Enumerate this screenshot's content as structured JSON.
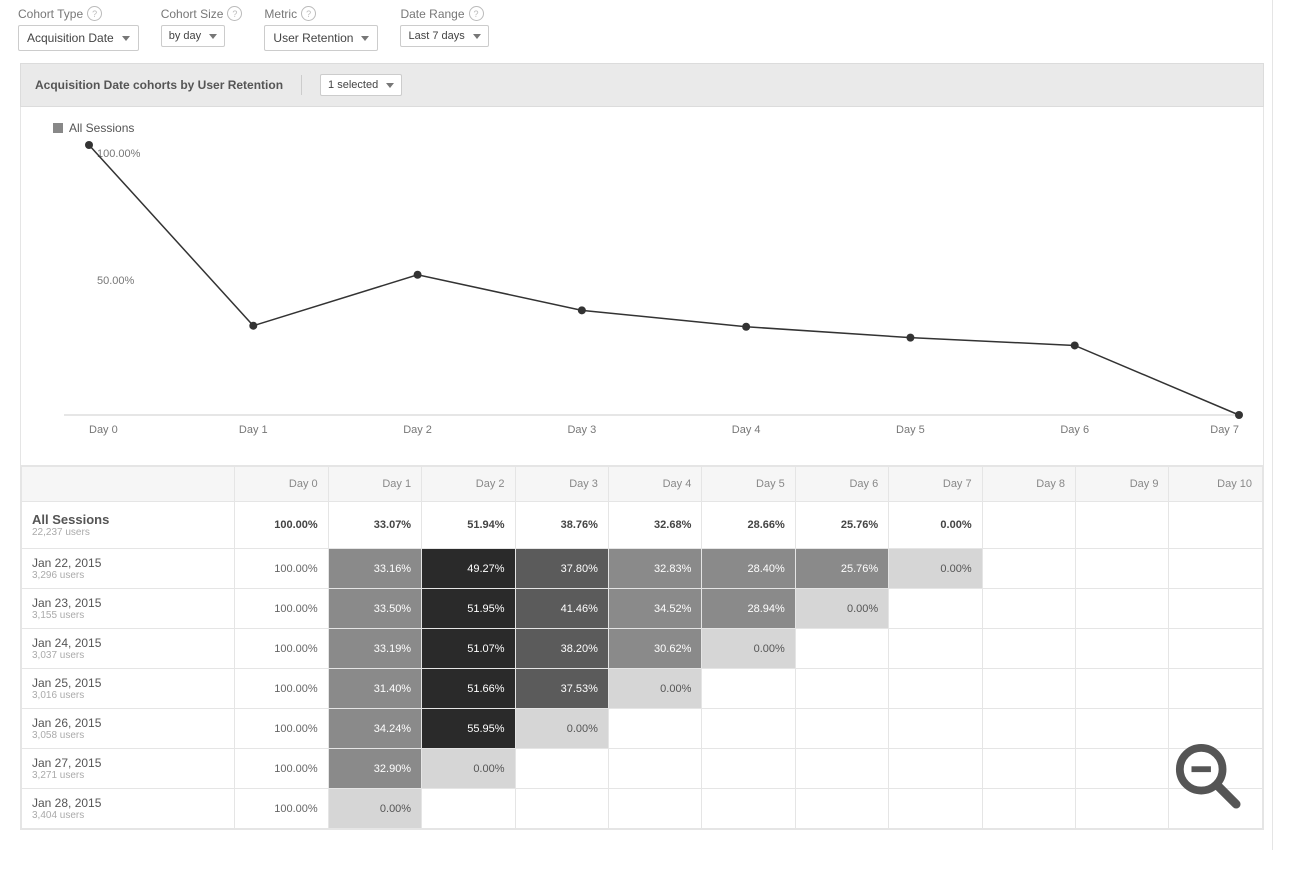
{
  "filters": {
    "cohort_type": {
      "label": "Cohort Type",
      "value": "Acquisition Date"
    },
    "cohort_size": {
      "label": "Cohort Size",
      "value": "by day"
    },
    "metric": {
      "label": "Metric",
      "value": "User Retention"
    },
    "date_range": {
      "label": "Date Range",
      "value": "Last 7 days"
    }
  },
  "report": {
    "title": "Acquisition Date cohorts by User Retention",
    "selector": "1 selected"
  },
  "legend": "All Sessions",
  "chart_data": {
    "type": "line",
    "title": "",
    "xlabel": "",
    "ylabel": "",
    "ylim": [
      0,
      100
    ],
    "y_ticks": [
      "100.00%",
      "50.00%"
    ],
    "categories": [
      "Day 0",
      "Day 1",
      "Day 2",
      "Day 3",
      "Day 4",
      "Day 5",
      "Day 6",
      "Day 7"
    ],
    "series": [
      {
        "name": "All Sessions",
        "values": [
          100.0,
          33.07,
          51.94,
          38.76,
          32.68,
          28.66,
          25.76,
          0.0
        ]
      }
    ]
  },
  "table": {
    "headers": [
      "",
      "Day 0",
      "Day 1",
      "Day 2",
      "Day 3",
      "Day 4",
      "Day 5",
      "Day 6",
      "Day 7",
      "Day 8",
      "Day 9",
      "Day 10"
    ],
    "summary": {
      "title": "All Sessions",
      "sub": "22,237 users",
      "cells": [
        "100.00%",
        "33.07%",
        "51.94%",
        "38.76%",
        "32.68%",
        "28.66%",
        "25.76%",
        "0.00%",
        "",
        "",
        ""
      ]
    },
    "rows": [
      {
        "title": "Jan 22, 2015",
        "sub": "3,296 users",
        "cells": [
          "100.00%",
          "33.16%",
          "49.27%",
          "37.80%",
          "32.83%",
          "28.40%",
          "25.76%",
          "0.00%",
          "",
          "",
          ""
        ]
      },
      {
        "title": "Jan 23, 2015",
        "sub": "3,155 users",
        "cells": [
          "100.00%",
          "33.50%",
          "51.95%",
          "41.46%",
          "34.52%",
          "28.94%",
          "0.00%",
          "",
          "",
          "",
          ""
        ]
      },
      {
        "title": "Jan 24, 2015",
        "sub": "3,037 users",
        "cells": [
          "100.00%",
          "33.19%",
          "51.07%",
          "38.20%",
          "30.62%",
          "0.00%",
          "",
          "",
          "",
          "",
          ""
        ]
      },
      {
        "title": "Jan 25, 2015",
        "sub": "3,016 users",
        "cells": [
          "100.00%",
          "31.40%",
          "51.66%",
          "37.53%",
          "0.00%",
          "",
          "",
          "",
          "",
          "",
          ""
        ]
      },
      {
        "title": "Jan 26, 2015",
        "sub": "3,058 users",
        "cells": [
          "100.00%",
          "34.24%",
          "55.95%",
          "0.00%",
          "",
          "",
          "",
          "",
          "",
          "",
          ""
        ]
      },
      {
        "title": "Jan 27, 2015",
        "sub": "3,271 users",
        "cells": [
          "100.00%",
          "32.90%",
          "0.00%",
          "",
          "",
          "",
          "",
          "",
          "",
          "",
          ""
        ]
      },
      {
        "title": "Jan 28, 2015",
        "sub": "3,404 users",
        "cells": [
          "100.00%",
          "0.00%",
          "",
          "",
          "",
          "",
          "",
          "",
          "",
          "",
          ""
        ]
      }
    ]
  }
}
